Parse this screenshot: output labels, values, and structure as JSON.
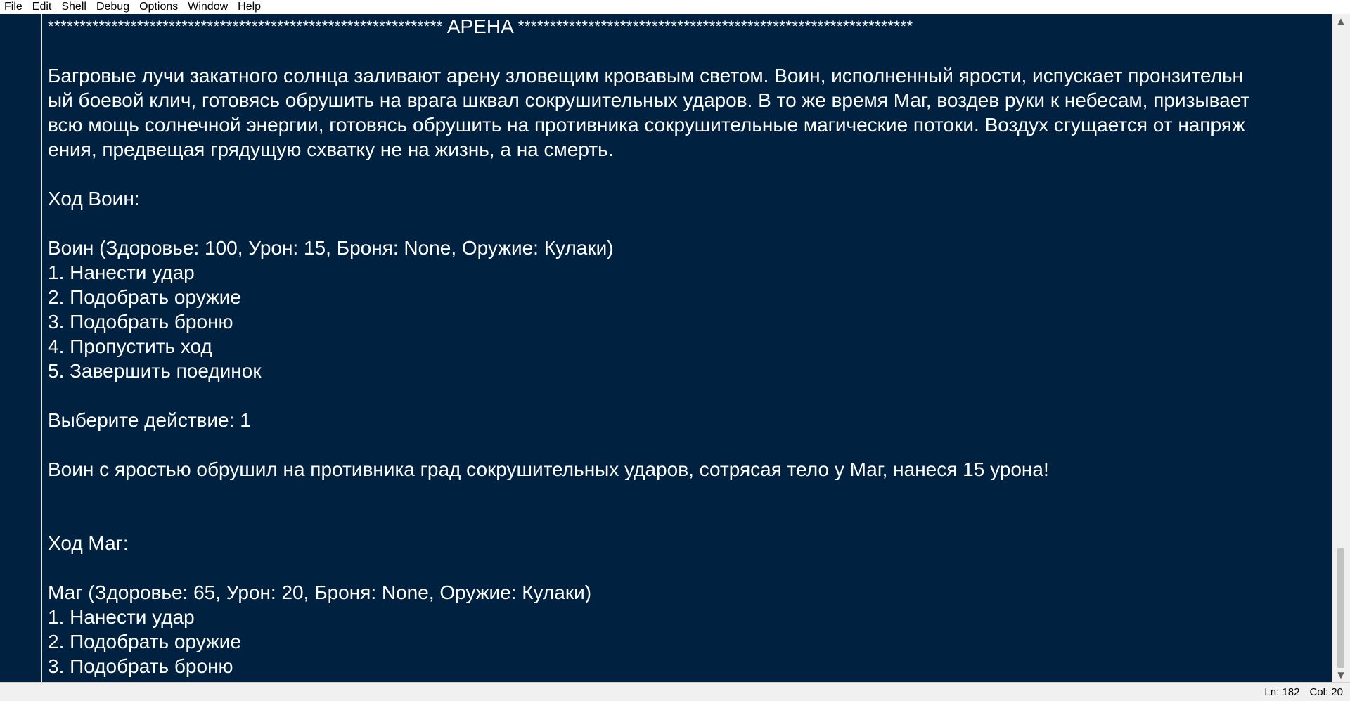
{
  "menu": {
    "items": [
      "File",
      "Edit",
      "Shell",
      "Debug",
      "Options",
      "Window",
      "Help"
    ]
  },
  "console": {
    "header_stars_left": "**************************************************************",
    "header_title": "АРЕНА",
    "header_stars_right": "**************************************************************",
    "lines": [
      "",
      "Багровые лучи закатного солнца заливают арену зловещим кровавым светом. Воин, исполненный ярости, испускает пронзительн",
      "ый боевой клич, готовясь обрушить на врага шквал сокрушительных ударов. В то же время Маг, воздев руки к небесам, призывает",
      "всю мощь солнечной энергии, готовясь обрушить на противника сокрушительные магические потоки. Воздух сгущается от напряж",
      "ения, предвещая грядущую схватку не на жизнь, а на смерть.",
      "",
      "Ход Воин:",
      "",
      "Воин (Здоровье: 100, Урон: 15, Броня: None, Оружие: Кулаки)",
      "1. Нанести удар",
      "2. Подобрать оружие",
      "3. Подобрать броню",
      "4. Пропустить ход",
      "5. Завершить поединок",
      "",
      "Выберите действие: 1",
      "",
      "Воин с яростью обрушил на противника град сокрушительных ударов, сотрясая тело у Маг, нанеся 15 урона!",
      "",
      "",
      "Ход Маг:",
      "",
      "Маг (Здоровье: 65, Урон: 20, Броня: None, Оружие: Кулаки)",
      "1. Нанести удар",
      "2. Подобрать оружие",
      "3. Подобрать броню"
    ]
  },
  "status": {
    "line": "Ln: 182",
    "col": "Col: 20"
  },
  "colors": {
    "editor_bg": "#002240",
    "text": "#ffffff"
  }
}
